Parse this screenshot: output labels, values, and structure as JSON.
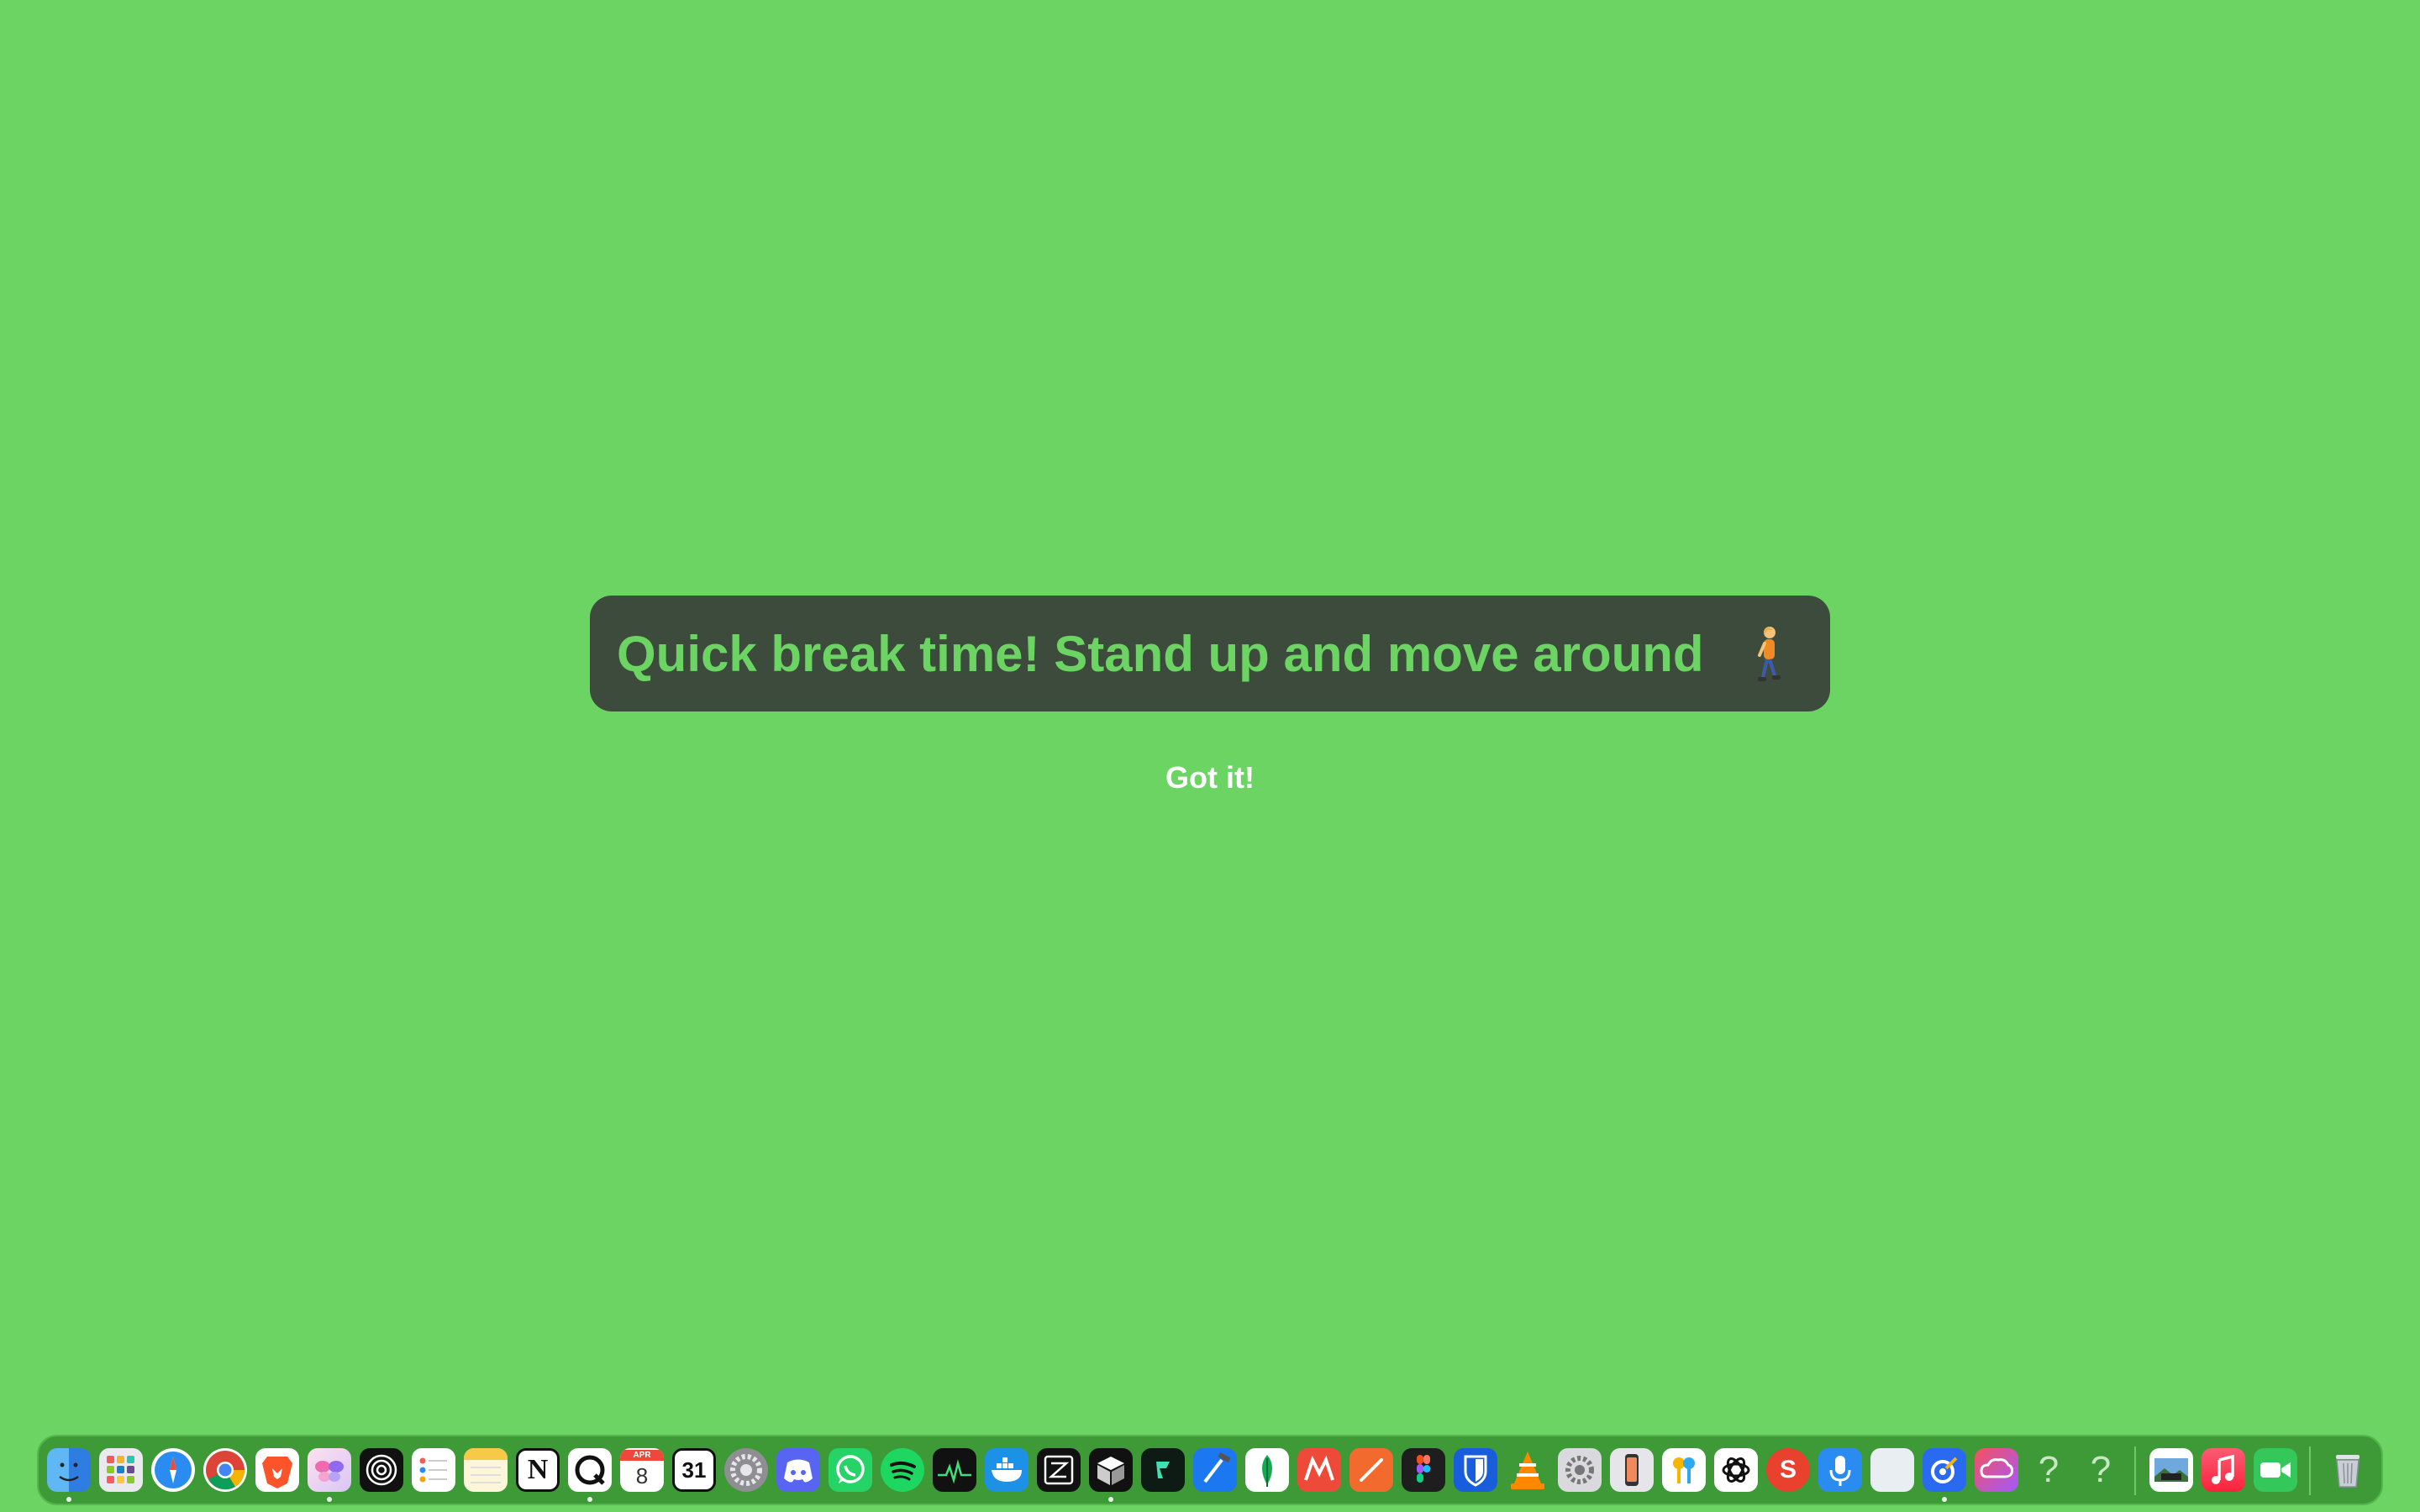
{
  "banner": {
    "text": "Quick break time! Stand up and move around"
  },
  "button": {
    "label": "Got it!"
  },
  "colors": {
    "background": "#6cd463",
    "banner": "#3c4b3b",
    "banner_text": "#6cd463",
    "dock": "#3e9a37"
  },
  "dock": {
    "calendar_month": "APR",
    "calendar_day": "8",
    "date_31": "31",
    "notion": "N",
    "help_glyph": "?",
    "s_glyph": "S"
  }
}
